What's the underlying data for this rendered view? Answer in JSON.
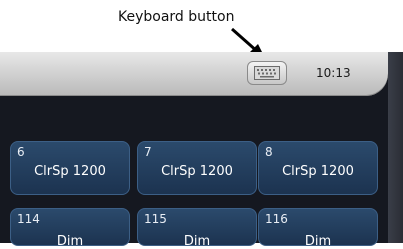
{
  "annotation": {
    "label": "Keyboard button"
  },
  "title_bar": {
    "keyboard_icon": "keyboard-icon",
    "clock": "10:13"
  },
  "fixtures": [
    {
      "number": "6",
      "name": "ClrSp 1200"
    },
    {
      "number": "7",
      "name": "ClrSp 1200"
    },
    {
      "number": "8",
      "name": "ClrSp 1200"
    },
    {
      "number": "114",
      "name": "Dim"
    },
    {
      "number": "115",
      "name": "Dim"
    },
    {
      "number": "116",
      "name": "Dim"
    }
  ]
}
